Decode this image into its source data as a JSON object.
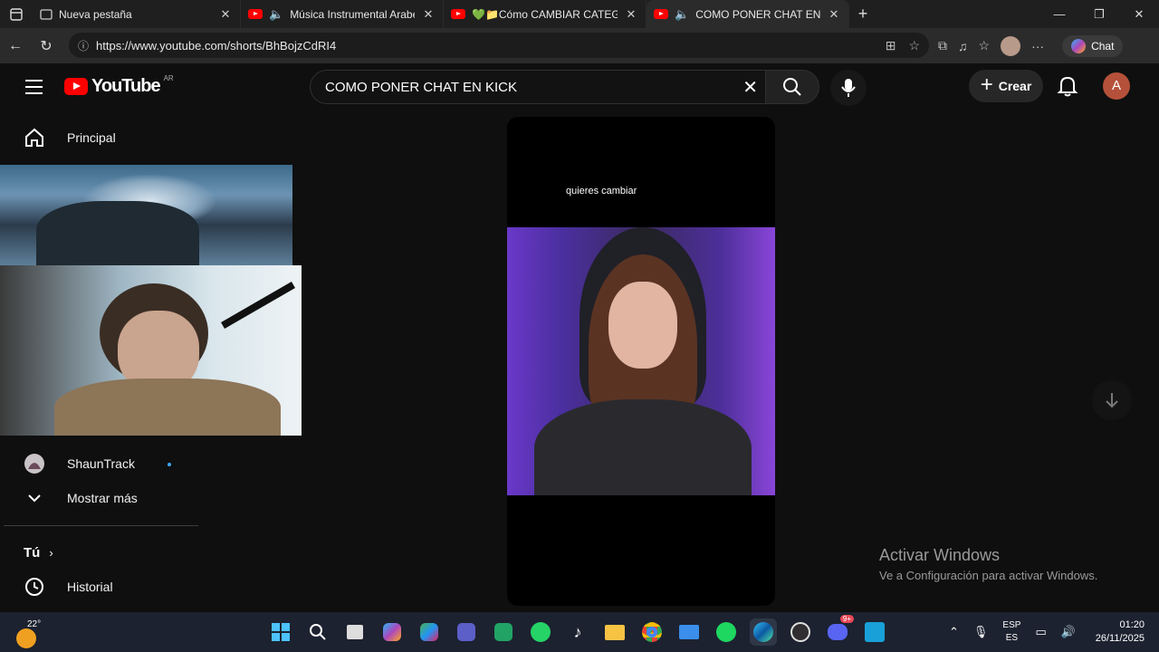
{
  "browser": {
    "tabs": [
      {
        "title": "Nueva pestaña",
        "favicon": "newtab-icon",
        "active": false
      },
      {
        "title": "Música Instrumental Arabe r",
        "favicon": "youtube-icon",
        "audio": true,
        "active": false
      },
      {
        "title": "💚📁Cómo CAMBIAR CATEGORÍ",
        "favicon": "youtube-icon",
        "active": false
      },
      {
        "title": "COMO PONER CHAT EN KIC",
        "favicon": "youtube-icon",
        "audio": true,
        "active": true
      }
    ],
    "url": "https://www.youtube.com/shorts/BhBojzCdRI4",
    "chat_label": "Chat"
  },
  "youtube": {
    "logo_text": "YouTube",
    "country_code": "AR",
    "search_query": "COMO PONER CHAT EN KICK",
    "create_label": "Crear",
    "avatar_letter": "A",
    "sidebar": {
      "home": "Principal",
      "subscription_channel": "ShaunTrack",
      "show_more": "Mostrar más",
      "you": "Tú",
      "history": "Historial"
    },
    "short": {
      "caption": "quieres cambiar"
    }
  },
  "watermark": {
    "line1": "Activar Windows",
    "line2": "Ve a Configuración para activar Windows."
  },
  "taskbar": {
    "temperature": "22°",
    "lang_top": "ESP",
    "lang_bottom": "ES",
    "time": "01:20",
    "date": "26/11/2025",
    "discord_badge": "9+"
  },
  "colors": {
    "youtube_red": "#ff0000",
    "background": "#0f0f0f",
    "avatar": "#b5513a"
  }
}
